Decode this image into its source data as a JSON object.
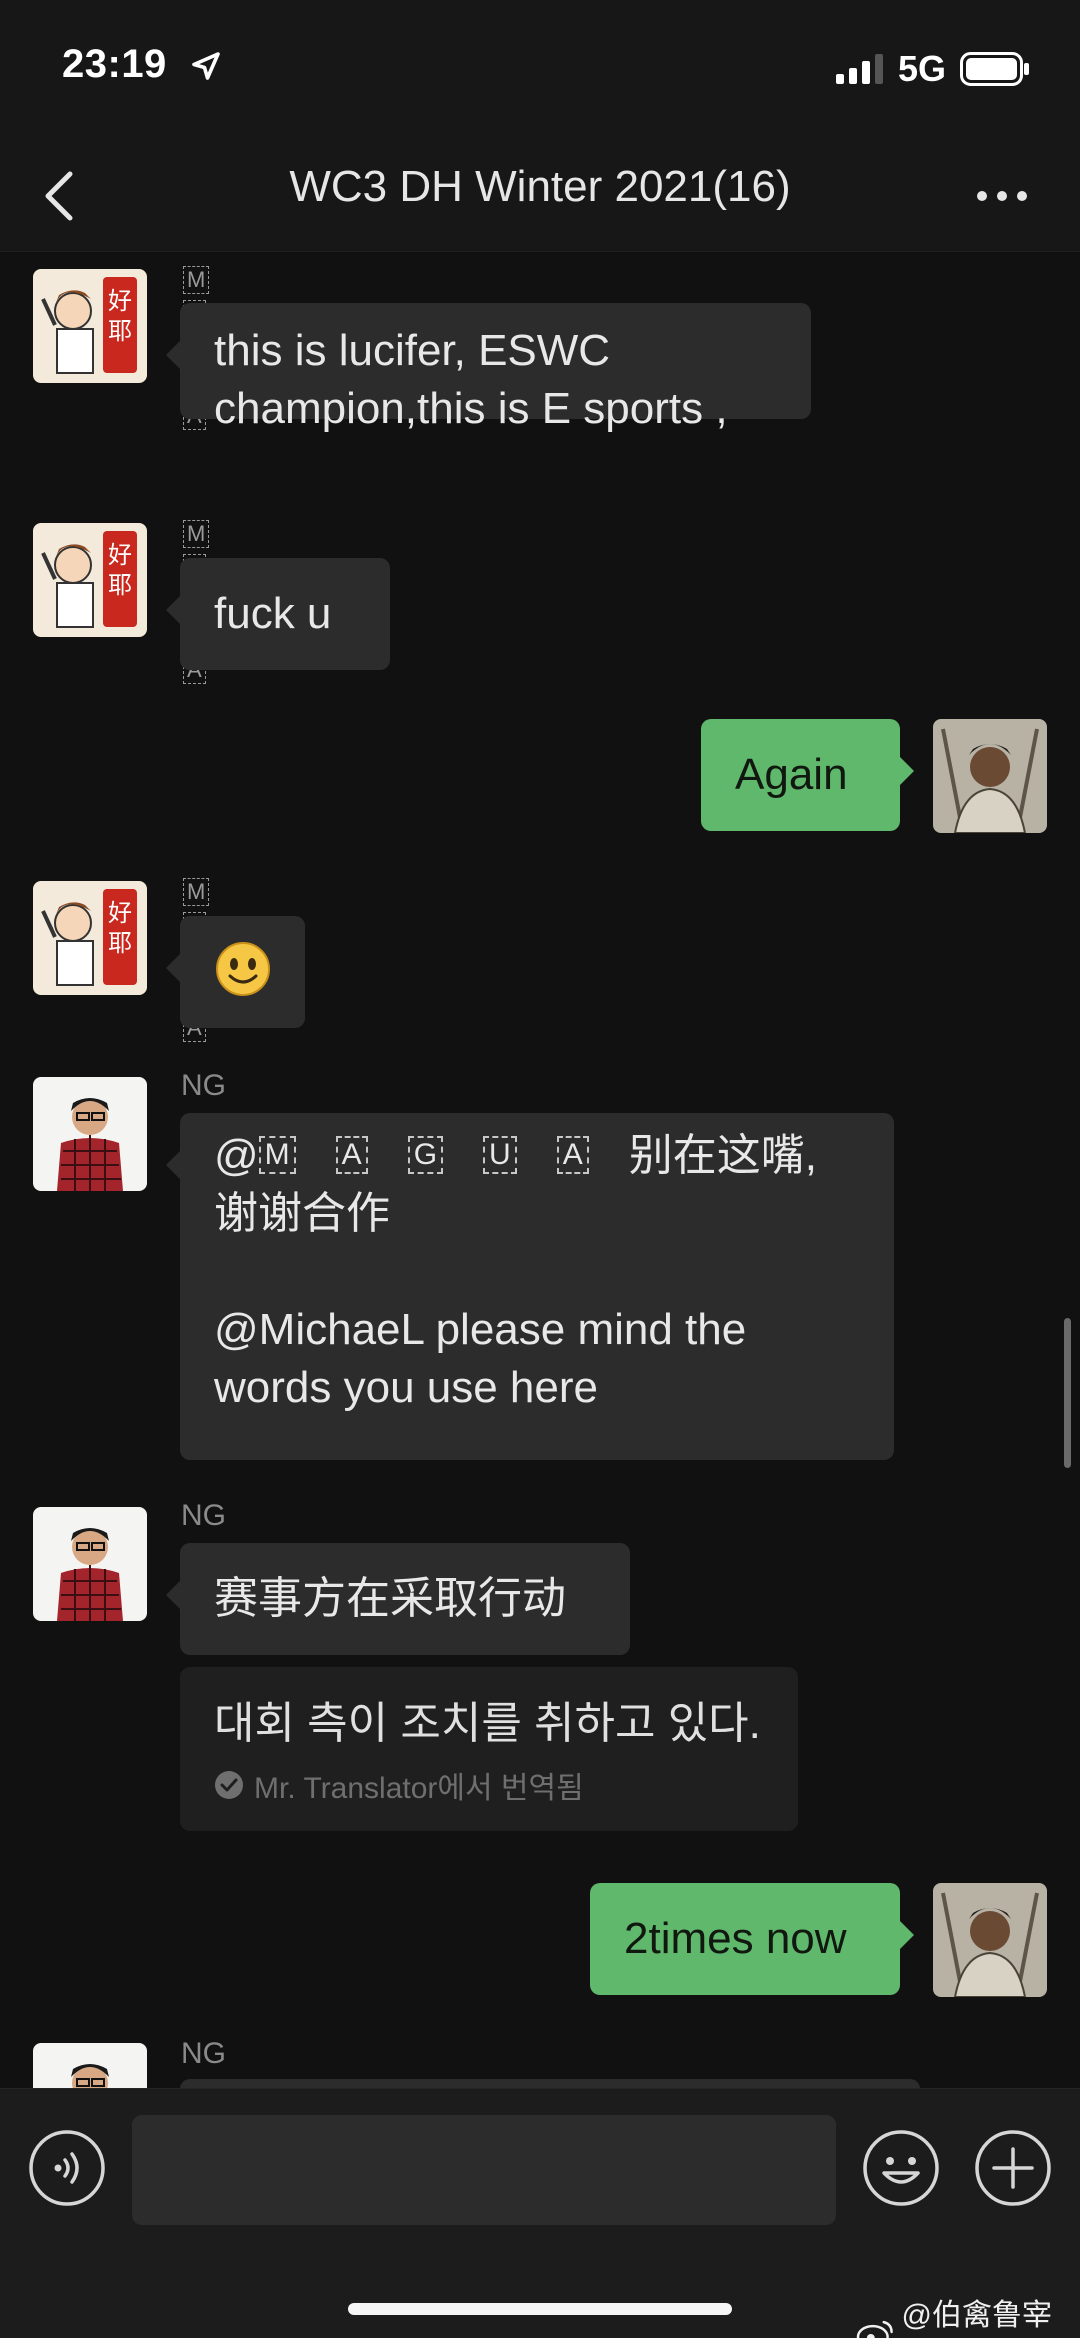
{
  "status_bar": {
    "time": "23:19",
    "network": "5G"
  },
  "header": {
    "title": "WC3 DH Winter 2021(16)"
  },
  "messages": [
    {
      "sender": "MAGUA",
      "text_line1": "this is lucifer, ESWC",
      "text_line2": "champion,this is E sports ,"
    },
    {
      "sender": "MAGUA",
      "text": "fuck u"
    },
    {
      "text": "Again"
    },
    {
      "sender": "MAGUA",
      "emoji": "🙂"
    },
    {
      "sender": "NG",
      "mention": "@",
      "mention_name": "MAGUA",
      "text_line1_cn": "别在这嘴,",
      "text_line2_cn": "谢谢合作",
      "text_line3": "@MichaeL  please mind the",
      "text_line4": "words you use here"
    },
    {
      "sender": "NG",
      "text": "赛事方在采取行动",
      "translation": "대회 측이 조치를 취하고 있다.",
      "translation_note": "Mr. Translator에서 번역됨"
    },
    {
      "text": "2times now"
    },
    {
      "sender": "NG"
    }
  ],
  "input": {
    "placeholder": ""
  },
  "watermark": "@伯禽鲁宰旭",
  "colors": {
    "background": "#111111",
    "bubble_in": "#2c2c2c",
    "bubble_out": "#5fb86b"
  }
}
